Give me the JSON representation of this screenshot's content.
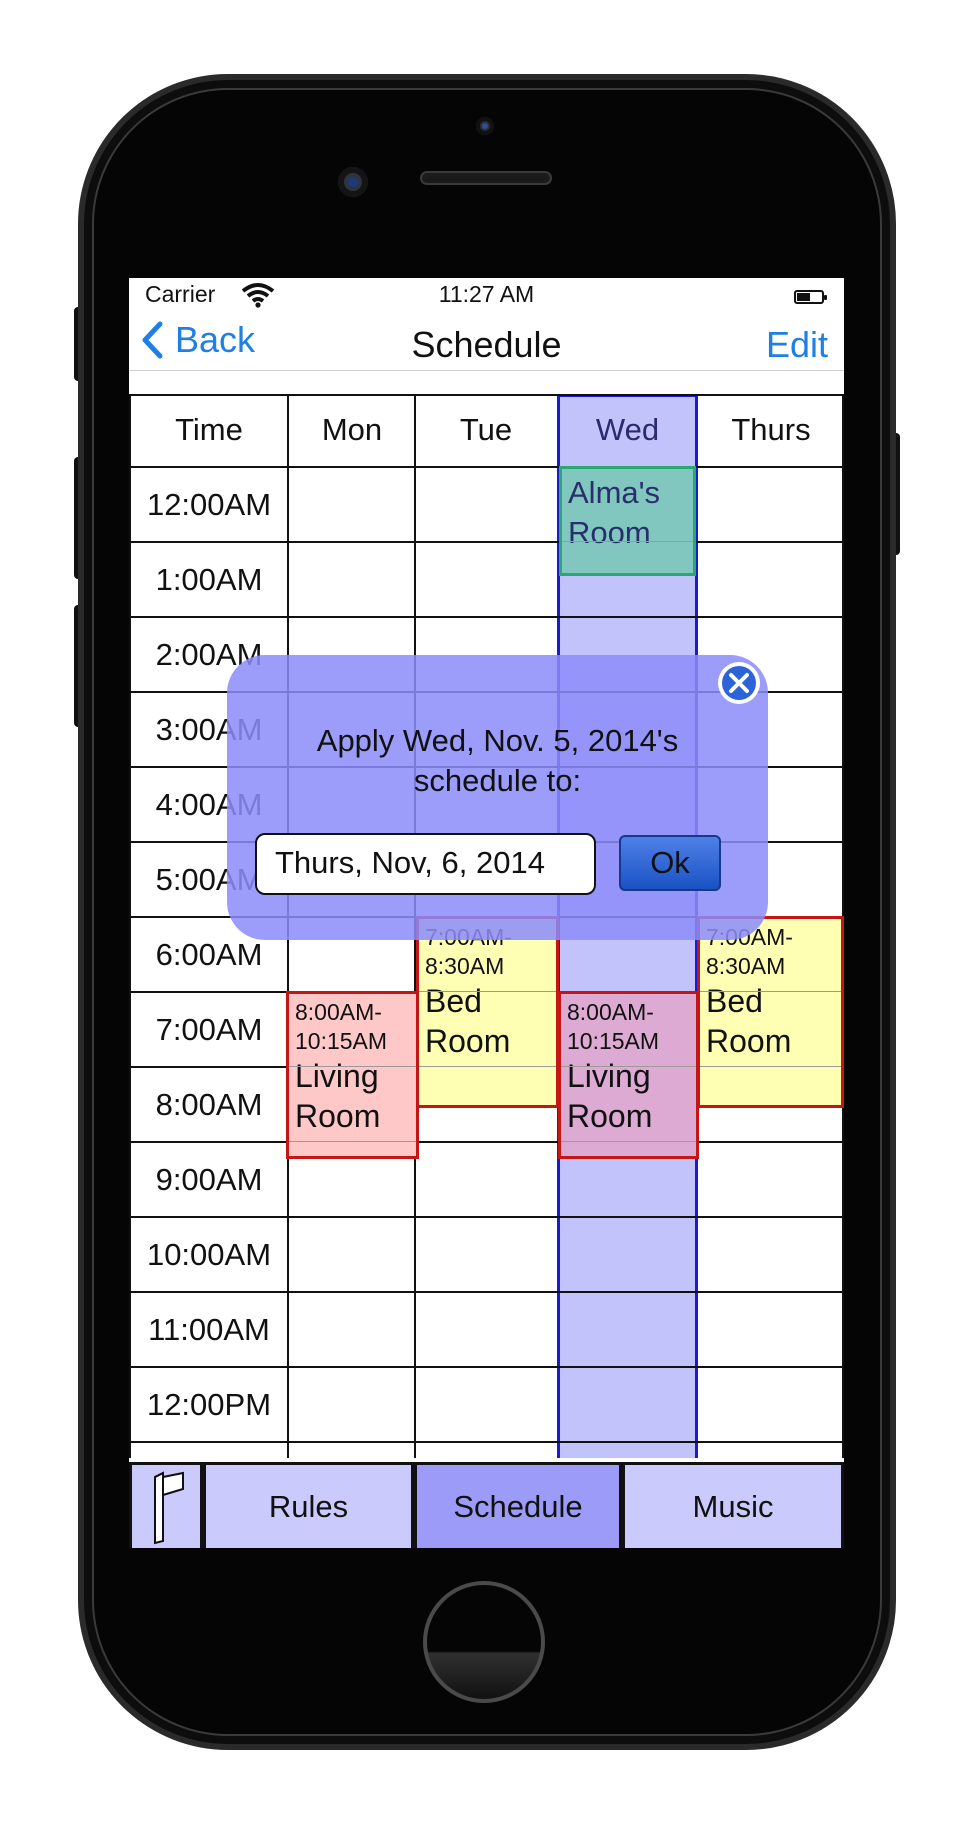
{
  "status_bar": {
    "carrier": "Carrier",
    "time": "11:27 AM"
  },
  "nav": {
    "back_label": "Back",
    "title": "Schedule",
    "edit_label": "Edit"
  },
  "schedule": {
    "headers": [
      "Time",
      "Mon",
      "Tue",
      "Wed",
      "Thurs"
    ],
    "selected_day": "Wed",
    "times": [
      "12:00AM",
      "1:00AM",
      "2:00AM",
      "3:00AM",
      "4:00AM",
      "5:00AM",
      "6:00AM",
      "7:00AM",
      "8:00AM",
      "9:00AM",
      "10:00AM",
      "11:00AM",
      "12:00PM"
    ],
    "events": [
      {
        "day": "Wed",
        "name": "Alma's Room",
        "color": "#82c6c0"
      },
      {
        "day": "Tue",
        "time": "7:00AM-8:30AM",
        "name": "Bed Room",
        "color": "#ffffb4"
      },
      {
        "day": "Thurs",
        "time": "7:00AM-8:30AM",
        "name": "Bed Room",
        "color": "#ffffb4"
      },
      {
        "day": "Mon",
        "time": "8:00AM-10:15AM",
        "name": "Living Room",
        "color": "#ffc8c8"
      },
      {
        "day": "Wed",
        "time": "8:00AM-10:15AM",
        "name": "Living Room",
        "color": "#dcaad2"
      }
    ]
  },
  "dialog": {
    "message": "Apply Wed, Nov. 5, 2014's schedule to:",
    "date_value": "Thurs, Nov, 6, 2014",
    "ok_label": "Ok"
  },
  "tabs": [
    {
      "label": "Rules"
    },
    {
      "label": "Schedule",
      "active": true
    },
    {
      "label": "Music"
    }
  ],
  "colors": {
    "accent": "#1e7fe5",
    "highlight_column": "#c3c3fb",
    "tab_active": "#9c9cf8",
    "tab_inactive": "#cacafc",
    "event_border": "#c51616"
  }
}
